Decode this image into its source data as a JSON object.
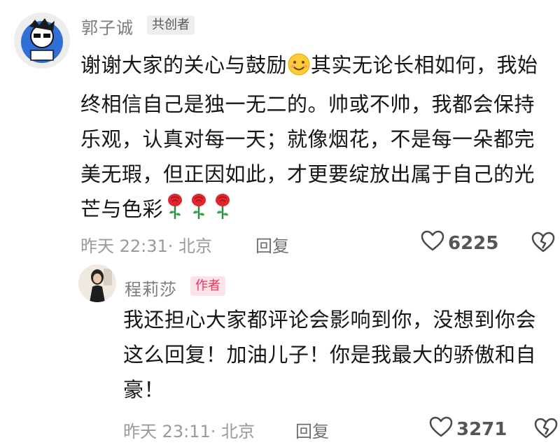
{
  "comment": {
    "author": "郭子诚",
    "badge": "共创者",
    "text_before_emoji": "谢谢大家的关心与鼓励",
    "emoji": "smiling-face-emoji",
    "text_after_emoji": "其实无论长相如何，我始终相信自己是独一无二的。帅或不帅，我都会保持乐观，认真对每一天；就像烟花，不是每一朵都完美无瑕，但正因如此，才更要绽放出属于自己的光芒与色彩",
    "trailing_emojis": [
      "rose-emoji",
      "rose-emoji",
      "rose-emoji"
    ],
    "time": "昨天 22:31· 北京",
    "reply_label": "回复",
    "likes": "6225"
  },
  "reply": {
    "author": "程莉莎",
    "badge": "作者",
    "text": "我还担心大家都评论会影响到你，没想到你会这么回复！加油儿子！你是我最大的骄傲和自豪！",
    "time": "昨天 23:11· 北京",
    "reply_label": "回复",
    "likes": "3271"
  },
  "colors": {
    "author_badge_bg": "#fbe3e8",
    "author_badge_text": "#f0335d",
    "cocreator_badge_bg": "#eeeeee",
    "meta_text": "#9a9a9a"
  }
}
